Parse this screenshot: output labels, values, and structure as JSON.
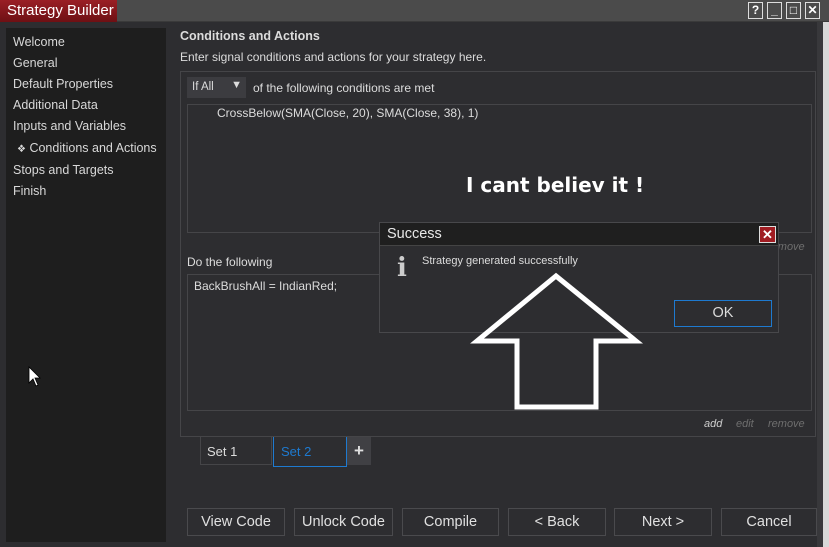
{
  "window": {
    "title": "Strategy Builder",
    "help": "?",
    "minimize": "_",
    "maximize": "□",
    "close": "✕"
  },
  "sidebar": {
    "items": [
      {
        "label": "Welcome"
      },
      {
        "label": "General"
      },
      {
        "label": "Default Properties"
      },
      {
        "label": "Additional Data"
      },
      {
        "label": "Inputs and Variables"
      },
      {
        "label": "Conditions and Actions",
        "selected": true,
        "bullet": "❖"
      },
      {
        "label": "Stops and Targets"
      },
      {
        "label": "Finish"
      }
    ]
  },
  "main": {
    "heading": "Conditions and Actions",
    "description": "Enter signal conditions and actions for your strategy here.",
    "condition_mode": "If All",
    "condition_suffix": "of the following conditions are met",
    "conditions": [
      "CrossBelow(SMA(Close, 20), SMA(Close, 38), 1)"
    ],
    "conditions_links": {
      "remove": "remove"
    },
    "annotation": "I cant believ it !",
    "actions_label": "Do the following",
    "actions": [
      "BackBrushAll = IndianRed;"
    ],
    "actions_links": {
      "add": "add",
      "edit": "edit",
      "remove": "remove"
    },
    "sets": [
      {
        "label": "Set 1"
      },
      {
        "label": "Set 2",
        "active": true
      }
    ],
    "add_set": "+"
  },
  "buttons": {
    "view_code": "View Code",
    "unlock_code": "Unlock Code",
    "compile": "Compile",
    "back": "< Back",
    "next": "Next >",
    "cancel": "Cancel"
  },
  "dialog": {
    "title": "Success",
    "icon": "info-icon",
    "message": "Strategy generated successfully",
    "ok": "OK"
  },
  "colors": {
    "accent": "#1e7ad0",
    "title_red": "#8a1a1f"
  }
}
